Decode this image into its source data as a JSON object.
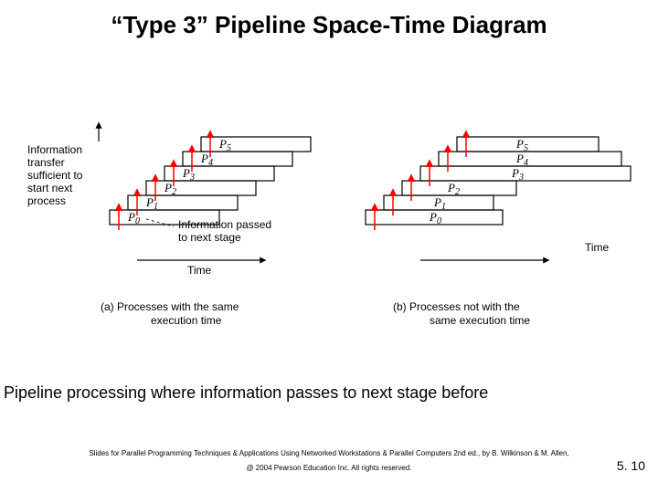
{
  "title": "“Type 3” Pipeline Space-Time Diagram",
  "diagram": {
    "left": {
      "processes": [
        {
          "label": "P",
          "sub": "0"
        },
        {
          "label": "P",
          "sub": "1"
        },
        {
          "label": "P",
          "sub": "2"
        },
        {
          "label": "P",
          "sub": "3"
        },
        {
          "label": "P",
          "sub": "4"
        },
        {
          "label": "P",
          "sub": "5"
        }
      ],
      "note1": [
        "Information",
        "transfer",
        "sufficient to",
        "start next",
        "process"
      ],
      "note2": [
        "Information passed",
        "to next stage"
      ],
      "axis": "Time",
      "caption": [
        "(a) Processes with the same",
        "execution time"
      ]
    },
    "right": {
      "processes": [
        {
          "label": "P",
          "sub": "0"
        },
        {
          "label": "P",
          "sub": "1"
        },
        {
          "label": "P",
          "sub": "2"
        },
        {
          "label": "P",
          "sub": "3"
        },
        {
          "label": "P",
          "sub": "4"
        },
        {
          "label": "P",
          "sub": "5"
        }
      ],
      "axis": "Time",
      "caption": [
        "(b) Processes not with the",
        "same execution time"
      ]
    }
  },
  "subtitle": "Pipeline processing where information passes to next stage before",
  "footer1": "Slides for Parallel Programming Techniques & Applications Using Networked Workstations & Parallel Computers 2nd ed., by B. Wilkinson & M. Allen,",
  "footer2": "@ 2004 Pearson Education Inc. All rights reserved.",
  "pagenum": "5. 10"
}
